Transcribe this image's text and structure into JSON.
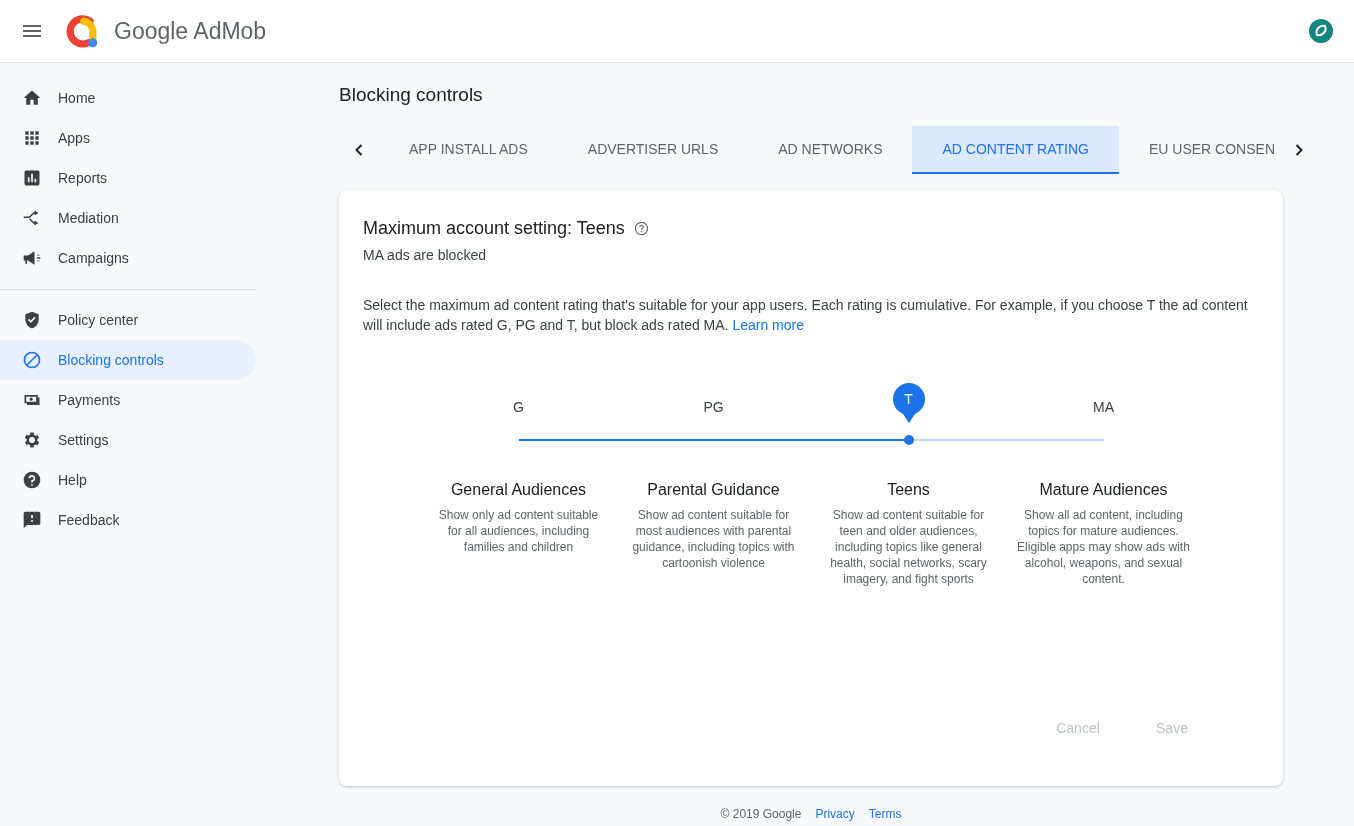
{
  "app": {
    "brand": "Google AdMob"
  },
  "sidebar": {
    "sections": [
      [
        {
          "label": "Home",
          "selected": false
        },
        {
          "label": "Apps",
          "selected": false
        },
        {
          "label": "Reports",
          "selected": false
        },
        {
          "label": "Mediation",
          "selected": false
        },
        {
          "label": "Campaigns",
          "selected": false
        }
      ],
      [
        {
          "label": "Policy center",
          "selected": false
        },
        {
          "label": "Blocking controls",
          "selected": true
        },
        {
          "label": "Payments",
          "selected": false
        },
        {
          "label": "Settings",
          "selected": false
        },
        {
          "label": "Help",
          "selected": false
        },
        {
          "label": "Feedback",
          "selected": false
        }
      ]
    ]
  },
  "page": {
    "title": "Blocking controls"
  },
  "tabs": [
    {
      "label": "APP INSTALL ADS",
      "selected": false
    },
    {
      "label": "ADVERTISER URLS",
      "selected": false
    },
    {
      "label": "AD NETWORKS",
      "selected": false
    },
    {
      "label": "AD CONTENT RATING",
      "selected": true
    },
    {
      "label": "EU USER CONSEN",
      "selected": false
    }
  ],
  "card": {
    "heading": "Maximum account setting: Teens",
    "subheading": "MA ads are blocked",
    "description": "Select the maximum ad content rating that's suitable for your app users. Each rating is cumulative. For example, if you choose T the ad content will include ads rated G, PG and T, but block ads rated MA.",
    "learn_more": "Learn more",
    "slider": {
      "level": 0.667
    },
    "ratings": [
      {
        "code": "G",
        "selected": false,
        "title": "General Audiences",
        "description": "Show only ad content suitable for all audiences, including families and children"
      },
      {
        "code": "PG",
        "selected": false,
        "title": "Parental Guidance",
        "description": "Show ad content suitable for most audiences with parental guidance, including topics with cartoonish violence"
      },
      {
        "code": "T",
        "selected": true,
        "title": "Teens",
        "description": "Show ad content suitable for teen and older audiences, including topics like general health, social networks, scary imagery, and fight sports"
      },
      {
        "code": "MA",
        "selected": false,
        "title": "Mature Audiences",
        "description": "Show all ad content, including topics for mature audiences. Eligible apps may show ads with alcohol, weapons, and sexual content."
      }
    ],
    "buttons": [
      {
        "label": "Cancel",
        "disabled": true
      },
      {
        "label": "Save",
        "disabled": true
      }
    ]
  },
  "footer": {
    "copyright": "© 2019 Google",
    "links": [
      "Privacy",
      "Terms"
    ]
  }
}
